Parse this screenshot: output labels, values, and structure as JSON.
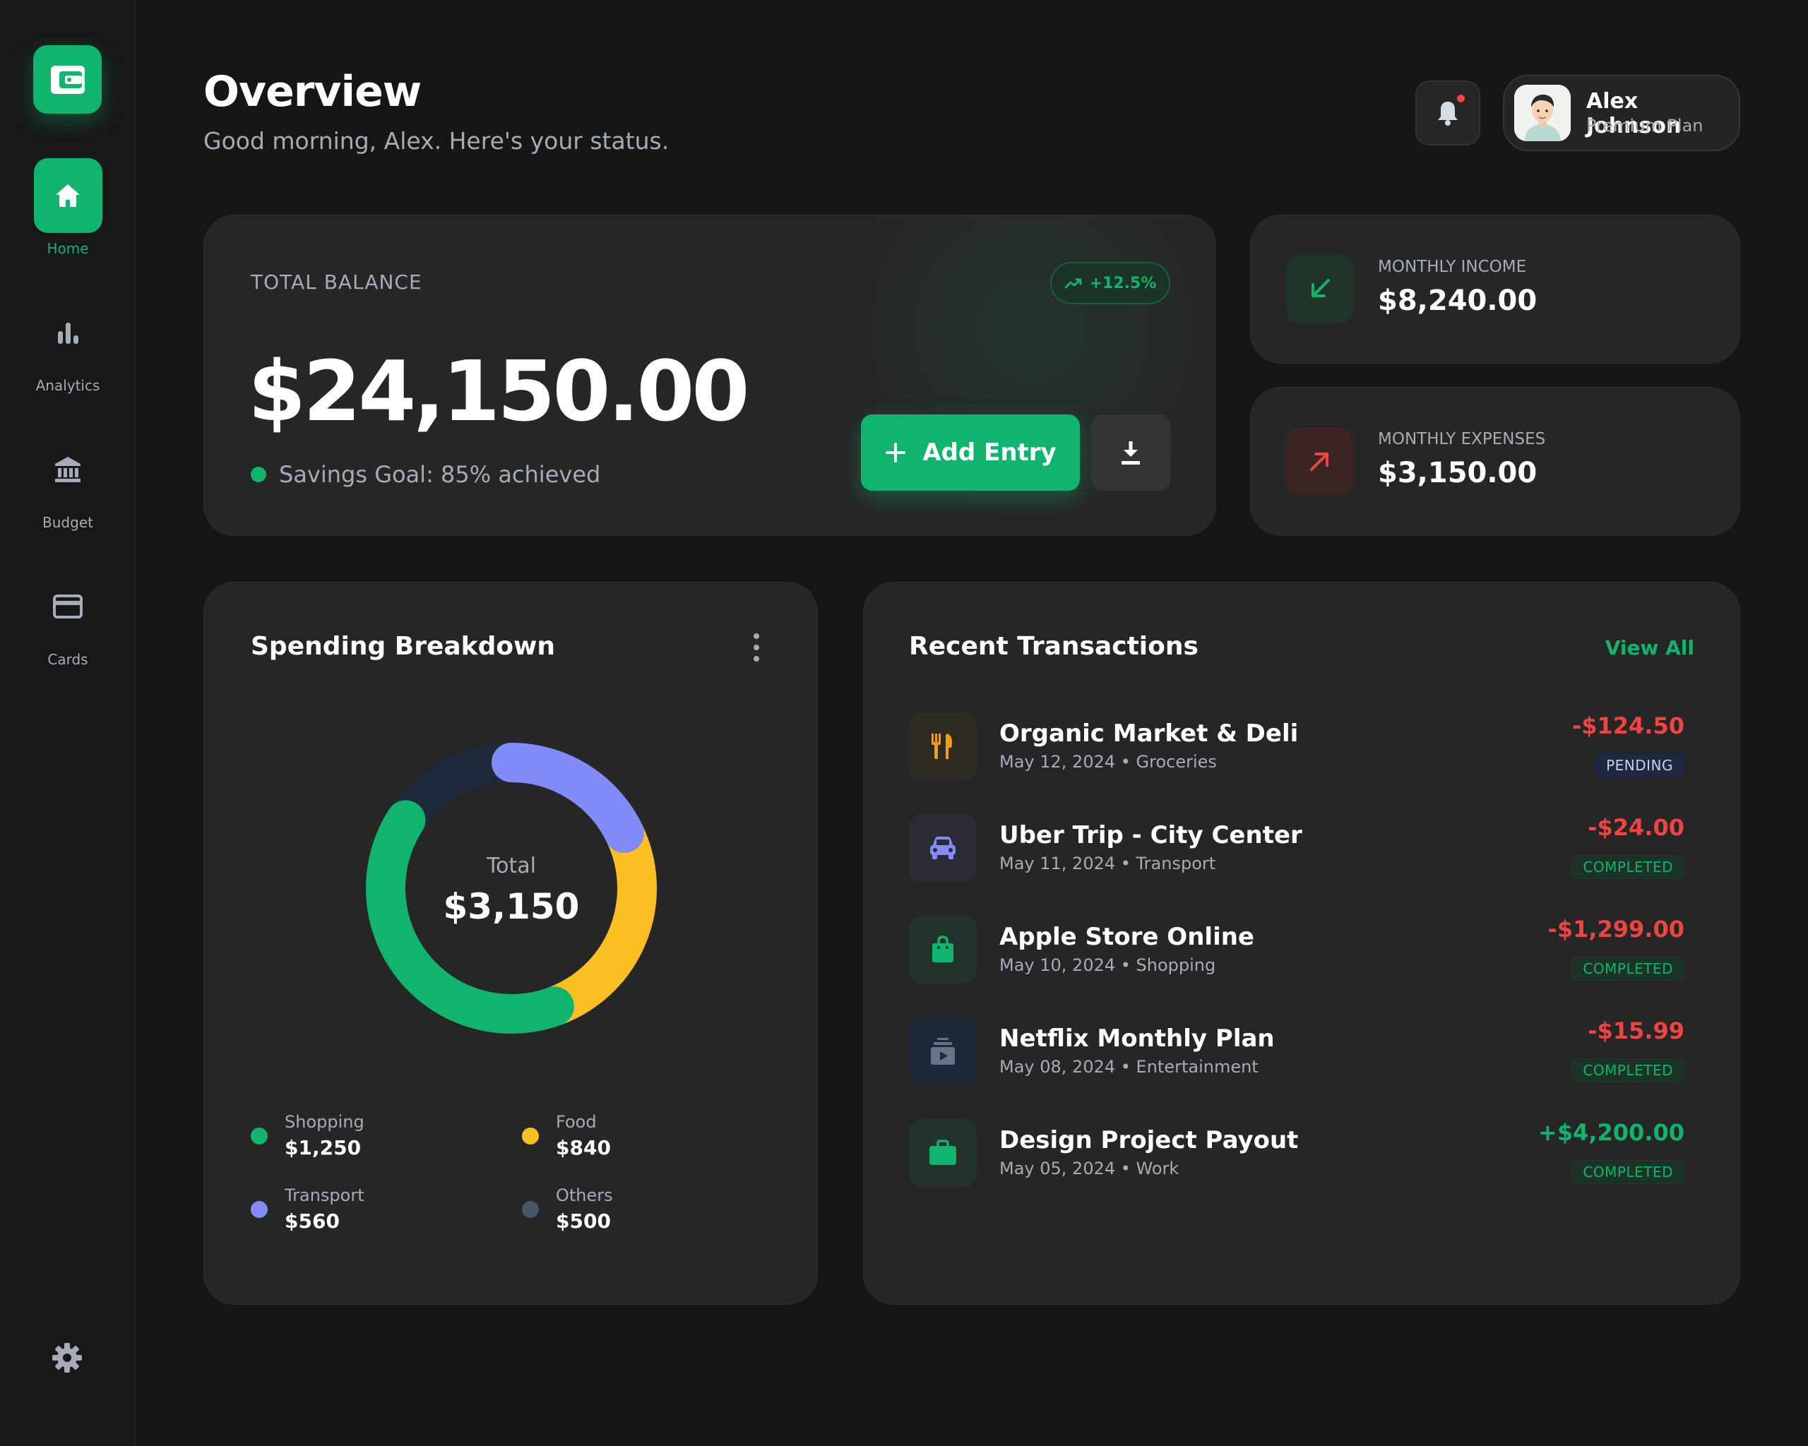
{
  "sidebar": {
    "logo_icon": "wallet-icon",
    "items": [
      {
        "label": "Home",
        "icon": "home-icon",
        "active": true
      },
      {
        "label": "Analytics",
        "icon": "bar-chart-icon",
        "active": false
      },
      {
        "label": "Budget",
        "icon": "bank-icon",
        "active": false
      },
      {
        "label": "Cards",
        "icon": "credit-card-icon",
        "active": false
      }
    ],
    "settings_icon": "gear-icon"
  },
  "header": {
    "title": "Overview",
    "subtitle": "Good morning, Alex. Here's your status.",
    "notification_icon": "bell-icon",
    "has_unread": true,
    "user": {
      "name": "Alex Johnson",
      "plan": "Premium Plan"
    }
  },
  "balance": {
    "label": "TOTAL BALANCE",
    "amount": "$24,150.00",
    "change": "+12.5%",
    "savings_text": "Savings Goal: 85% achieved",
    "add_button_label": "Add Entry",
    "download_icon": "download-icon"
  },
  "income": {
    "label": "MONTHLY INCOME",
    "value": "$8,240.00",
    "icon": "arrow-down-left-icon"
  },
  "expenses": {
    "label": "MONTHLY EXPENSES",
    "value": "$3,150.00",
    "icon": "arrow-up-right-icon"
  },
  "spending": {
    "title": "Spending Breakdown",
    "total_label": "Total",
    "total_value": "$3,150",
    "legend": [
      {
        "name": "Shopping",
        "value": "$1,250",
        "color": "#10b46c"
      },
      {
        "name": "Food",
        "value": "$840",
        "color": "#fbbf24"
      },
      {
        "name": "Transport",
        "value": "$560",
        "color": "#818cf8"
      },
      {
        "name": "Others",
        "value": "$500",
        "color": "#475569"
      }
    ]
  },
  "chart_data": {
    "type": "pie",
    "categories": [
      "Transport",
      "Food",
      "Shopping",
      "Others"
    ],
    "values": [
      560,
      840,
      1250,
      500
    ],
    "colors": [
      "#818cf8",
      "#fbbf24",
      "#10b46c",
      "#1e293b"
    ],
    "title": "Spending Breakdown"
  },
  "transactions": {
    "title": "Recent Transactions",
    "view_all": "View All",
    "items": [
      {
        "name": "Organic Market & Deli",
        "meta": "May 12, 2024 • Groceries",
        "amount": "-$124.50",
        "status": "PENDING",
        "icon": "fork-knife-icon",
        "icon_color": "#f59e0b",
        "icon_bg": "#2f2a22",
        "positive": false
      },
      {
        "name": "Uber Trip - City Center",
        "meta": "May 11, 2024 • Transport",
        "amount": "-$24.00",
        "status": "COMPLETED",
        "icon": "car-icon",
        "icon_color": "#818cf8",
        "icon_bg": "#2b2b36",
        "positive": false
      },
      {
        "name": "Apple Store Online",
        "meta": "May 10, 2024 • Shopping",
        "amount": "-$1,299.00",
        "status": "COMPLETED",
        "icon": "shopping-bag-icon",
        "icon_color": "#10b46c",
        "icon_bg": "#21332a",
        "positive": false
      },
      {
        "name": "Netflix Monthly Plan",
        "meta": "May 08, 2024 • Entertainment",
        "amount": "-$15.99",
        "status": "COMPLETED",
        "icon": "video-library-icon",
        "icon_color": "#64748b",
        "icon_bg": "#1e2838",
        "positive": false
      },
      {
        "name": "Design Project Payout",
        "meta": "May 05, 2024 • Work",
        "amount": "+$4,200.00",
        "status": "COMPLETED",
        "icon": "briefcase-icon",
        "icon_color": "#10b46c",
        "icon_bg": "#21332a",
        "positive": true
      }
    ]
  }
}
